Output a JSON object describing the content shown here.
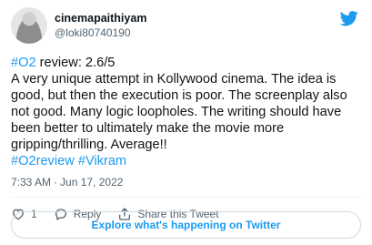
{
  "author": {
    "display_name": "cinemapaithiyam",
    "handle": "@loki80740190"
  },
  "tweet": {
    "line1_hashtag": "#O2",
    "line1_rest": " review: 2.6/5",
    "body": "A very unique attempt in Kollywood cinema. The idea is good, but then the execution is poor. The screenplay also not good. Many logic loopholes. The writing should have been better to ultimately make the movie more gripping/thrilling. Average!!",
    "tag1": "#O2review",
    "tag2": "#Vikram",
    "time": "7:33 AM",
    "separator": "·",
    "date": "Jun 17, 2022"
  },
  "actions": {
    "like_count": "1",
    "reply_label": "Reply",
    "share_label": "Share this Tweet"
  },
  "explore": {
    "label": "Explore what's happening on Twitter"
  },
  "icons": {
    "brand": "twitter-bird-icon",
    "like": "heart-icon",
    "reply": "comment-icon",
    "share": "share-icon"
  },
  "colors": {
    "accent": "#1d9bf0",
    "text": "#0f1419",
    "muted": "#536471",
    "border": "#cfd9de"
  }
}
